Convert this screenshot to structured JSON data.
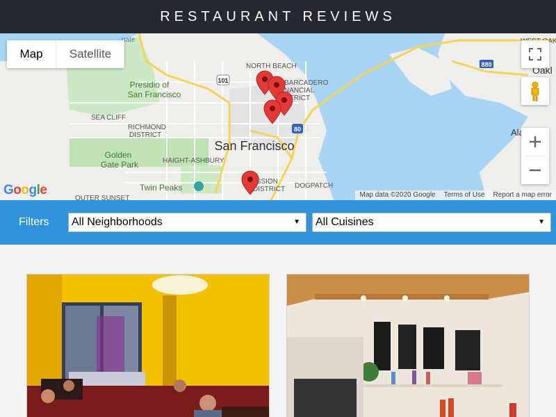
{
  "header": {
    "title": "RESTAURANT REVIEWS"
  },
  "map": {
    "type_control": {
      "map_label": "Map",
      "satellite_label": "Satellite",
      "selected": "Map"
    },
    "attribution": {
      "map_data": "Map data ©2020 Google",
      "terms": "Terms of Use",
      "report": "Report a map error"
    },
    "logo": "Google",
    "labels": {
      "city": "San Francisco",
      "north_beach": "NORTH BEACH",
      "embarcadero": "EMBARCADERO",
      "financial": "FINANCIAL",
      "district": "DISTRICT",
      "presidio_1": "Presidio of",
      "presidio_2": "San Francisco",
      "sea_cliff": "SEA CLIFF",
      "richmond_1": "RICHMOND",
      "richmond_2": "DISTRICT",
      "golden_gate_1": "Golden",
      "golden_gate_2": "Gate Park",
      "haight": "HAIGHT-ASHBURY",
      "twin_peaks": "Twin Peaks",
      "mission_1": "ISSION",
      "mission_2": "DISTRICT",
      "dogpatch": "DOGPATCH",
      "outer_sunset": "OUTER SUNSET",
      "west_oakland": "WEST OAKLAND",
      "oakland": "Oakl",
      "alameda": "Ala",
      "hwy_101": "101",
      "hwy_80": "80",
      "hwy_880": "880",
      "gate": "gate"
    },
    "markers_count": 5
  },
  "filters": {
    "label": "Filters",
    "neighborhood": {
      "selected": "All Neighborhoods"
    },
    "cuisine": {
      "selected": "All Cuisines"
    }
  },
  "restaurants": [
    {
      "image": "restaurant interior with yellow walls and diners"
    },
    {
      "image": "restaurant interior with wooden ceiling and wall art"
    }
  ]
}
